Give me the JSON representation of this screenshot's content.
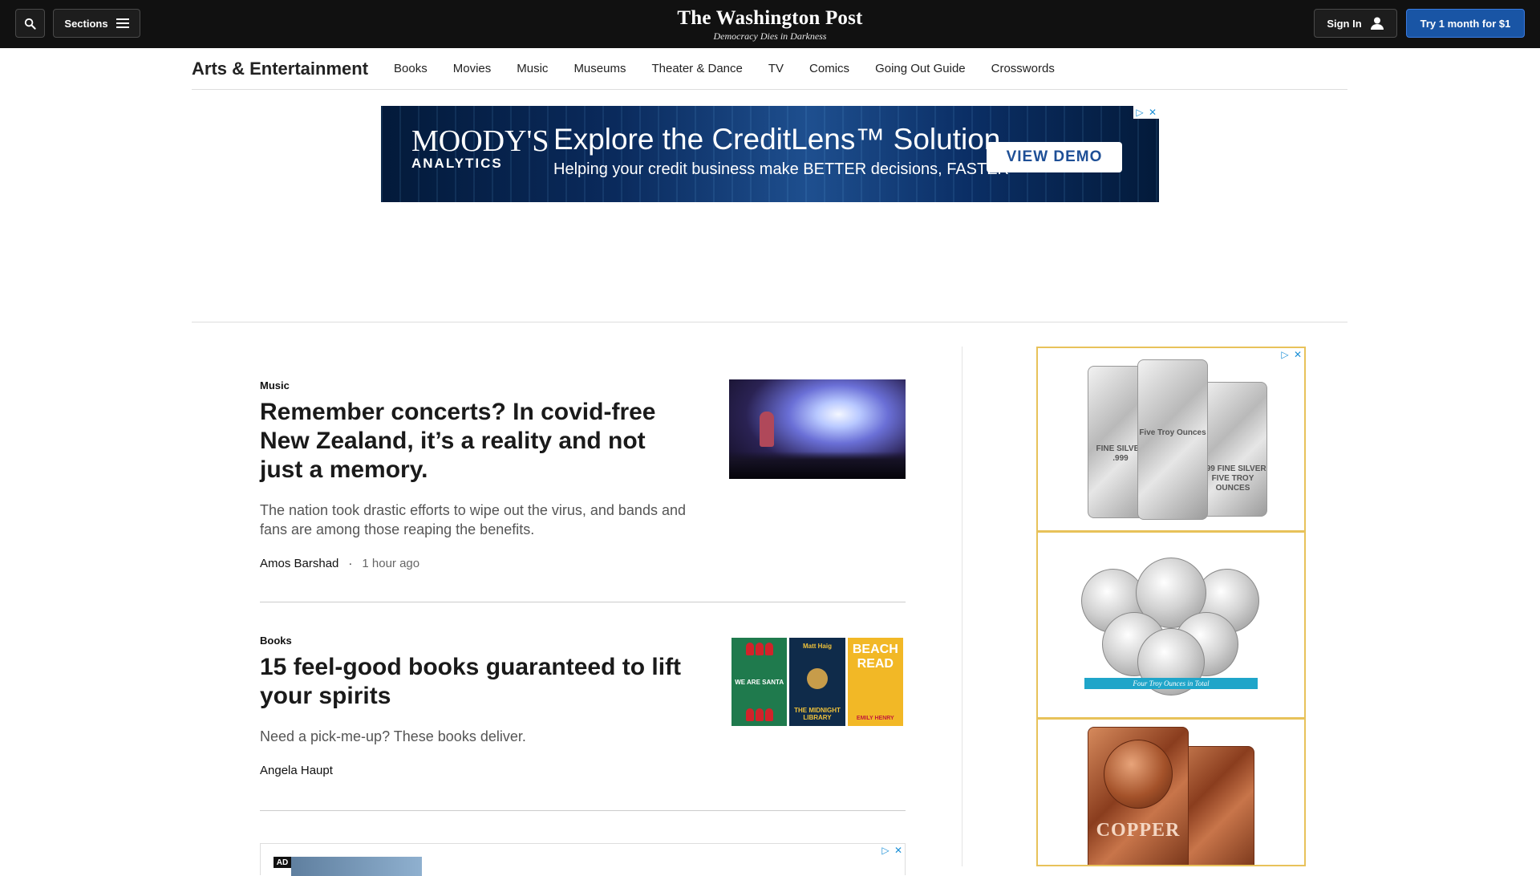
{
  "header": {
    "sections_label": "Sections",
    "logo": "The Washington Post",
    "tagline": "Democracy Dies in Darkness",
    "signin_label": "Sign In",
    "subscribe_label": "Try 1 month for $1"
  },
  "section_nav": {
    "title": "Arts & Entertainment",
    "items": [
      "Books",
      "Movies",
      "Music",
      "Museums",
      "Theater & Dance",
      "TV",
      "Comics",
      "Going Out Guide",
      "Crosswords"
    ]
  },
  "banner_ad": {
    "brand": "MOODY'S",
    "brand_sub": "ANALYTICS",
    "headline": "Explore the CreditLens™ Solution",
    "subline": "Helping your credit business make BETTER decisions, FASTER",
    "cta": "VIEW DEMO"
  },
  "articles": [
    {
      "kicker": "Music",
      "headline": "Remember concerts? In covid-free New Zealand, it’s a reality and not just a memory.",
      "blurb": "The nation took drastic efforts to wipe out the virus, and bands and fans are among those reaping the benefits.",
      "author": "Amos Barshad",
      "time": "1 hour ago"
    },
    {
      "kicker": "Books",
      "headline": "15 feel-good books guaranteed to lift your spirits",
      "blurb": "Need a pick-me-up? These books deliver.",
      "author": "Angela Haupt",
      "books": [
        {
          "title": "WE ARE SANTA"
        },
        {
          "title": "THE MIDNIGHT LIBRARY",
          "author": "Matt Haig"
        },
        {
          "title": "BEACH READ",
          "author": "EMILY HENRY"
        }
      ]
    }
  ],
  "bottom_ad": {
    "label": "AD"
  },
  "rail_ad": {
    "panel1": {
      "bar1": "FINE SILVER .999",
      "bar2": "Five Troy Ounces",
      "bar3": ".999 FINE SILVER FIVE TROY OUNCES"
    },
    "panel2": {
      "ribbon": "Four Troy Ounces in Total"
    },
    "panel3": {
      "bar": "COPPER"
    }
  },
  "colors": {
    "topbar": "#111111",
    "subscribe_button": "#1955a5",
    "rail_ad_border": "#e8c25a"
  }
}
